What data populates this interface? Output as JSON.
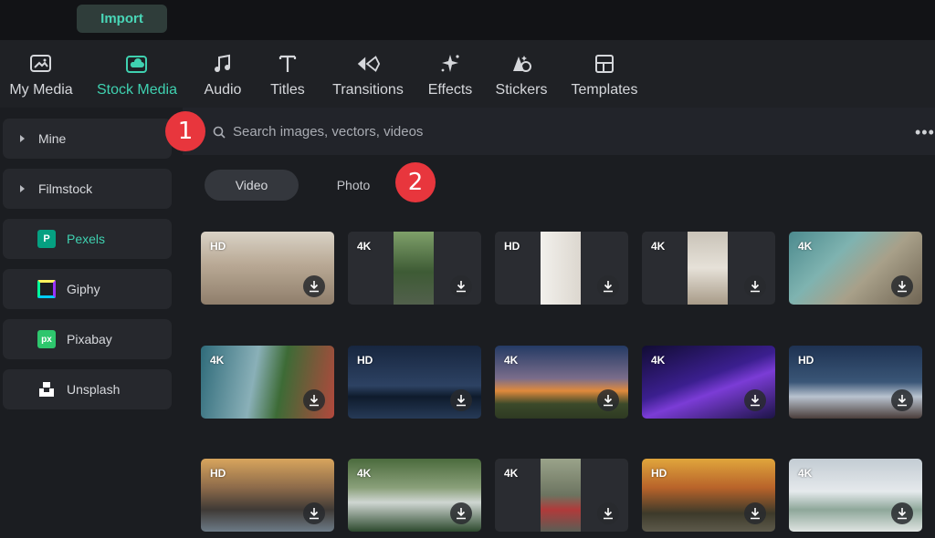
{
  "toolbar": {
    "import_label": "Import"
  },
  "tabs": [
    {
      "label": "My Media",
      "icon": "image-icon"
    },
    {
      "label": "Stock Media",
      "icon": "cloud-folder-icon",
      "active": true
    },
    {
      "label": "Audio",
      "icon": "music-note-icon"
    },
    {
      "label": "Titles",
      "icon": "title-t-icon"
    },
    {
      "label": "Transitions",
      "icon": "transition-icon"
    },
    {
      "label": "Effects",
      "icon": "sparkle-icon"
    },
    {
      "label": "Stickers",
      "icon": "sticker-icon"
    },
    {
      "label": "Templates",
      "icon": "template-grid-icon"
    }
  ],
  "sidebar": {
    "items": [
      {
        "label": "Mine"
      },
      {
        "label": "Filmstock"
      },
      {
        "label": "Pexels",
        "active": true
      },
      {
        "label": "Giphy"
      },
      {
        "label": "Pixabay"
      },
      {
        "label": "Unsplash"
      }
    ]
  },
  "search": {
    "placeholder": "Search images, vectors, videos"
  },
  "filters": {
    "video_label": "Video",
    "photo_label": "Photo"
  },
  "annotations": {
    "badge1": "1",
    "badge2": "2"
  },
  "colors": {
    "accent": "#3fd1b0",
    "badge": "#e8363d"
  },
  "grid": [
    {
      "quality": "HD"
    },
    {
      "quality": "4K"
    },
    {
      "quality": "HD"
    },
    {
      "quality": "4K"
    },
    {
      "quality": "4K"
    },
    {
      "quality": "4K"
    },
    {
      "quality": "HD"
    },
    {
      "quality": "4K"
    },
    {
      "quality": "4K"
    },
    {
      "quality": "HD"
    },
    {
      "quality": "HD"
    },
    {
      "quality": "4K"
    },
    {
      "quality": "4K"
    },
    {
      "quality": "HD"
    },
    {
      "quality": "4K"
    }
  ]
}
